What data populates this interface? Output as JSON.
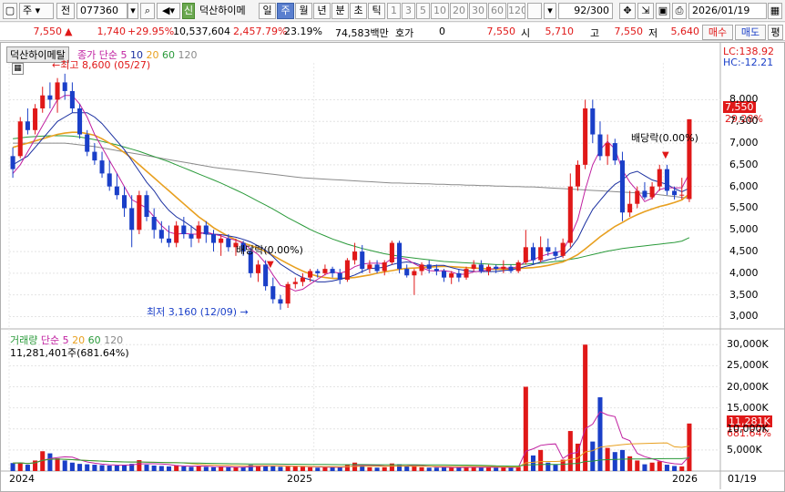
{
  "toolbar": {
    "market": "주",
    "type": "전",
    "code": "077360",
    "stock_name": "덕산하이메",
    "periods": [
      "일",
      "주",
      "월",
      "년",
      "분",
      "초",
      "틱"
    ],
    "active_period": "주",
    "intervals": [
      "1",
      "3",
      "5",
      "10",
      "20",
      "30",
      "60",
      "120"
    ],
    "count": "92/300",
    "date": "2026/01/19"
  },
  "info": {
    "price": "7,550",
    "change": "1,740",
    "change_pct": "+29.95%",
    "volume": "10,537,604",
    "volume_pct": "2,457.79%",
    "turnover": "23.19%",
    "amount": "74,583백만",
    "hoga_label": "호가",
    "hoga_value": "0",
    "hoga_price": "7,550",
    "open_label": "시",
    "open": "5,710",
    "high_label": "고",
    "high": "7,550",
    "low_label": "저",
    "low": "5,640",
    "buy": "매수",
    "sell": "매도",
    "eval": "평"
  },
  "price_panel": {
    "name_tag": "덕산하이메탈",
    "legend_prefix": "종가 단순",
    "legend_ma": [
      "5",
      "10",
      "20",
      "60",
      "120"
    ],
    "lc": "LC:138.92",
    "hc": "HC:-12.21",
    "current_tag": "7,550",
    "current_pct": "29.28%",
    "high_note": "최고 8,600 (05/27)",
    "low_note": "최저 3,160 (12/09)",
    "div1": "배당락(0.00%)",
    "div2": "배당락(0.00%)",
    "y_ticks": [
      "8,000",
      "7,500",
      "7,000",
      "6,500",
      "6,000",
      "5,500",
      "5,000",
      "4,500",
      "4,000",
      "3,500",
      "3,000"
    ]
  },
  "volume_panel": {
    "title": "거래량",
    "legend_prefix": "단순",
    "legend_ma": [
      "5",
      "20",
      "60",
      "120"
    ],
    "current": "11,281,401주(681.64%)",
    "tag": "11,281K",
    "tag_pct": "681.64%",
    "y_ticks": [
      "30,000K",
      "25,000K",
      "20,000K",
      "15,000K",
      "10,000K",
      "5,000K"
    ]
  },
  "x_axis": {
    "labels": [
      "2024",
      "2025",
      "2026"
    ],
    "right": "01/19"
  },
  "colors": {
    "up": "#e01818",
    "down": "#1a3fc8",
    "ma5": "#c020a0",
    "ma10": "#1a2fa0",
    "ma20": "#e8a020",
    "ma60": "#2a9a3a",
    "ma120": "#8a8a8a"
  },
  "chart_data": {
    "type": "candlestick",
    "candles": [
      [
        6700,
        6900,
        6200,
        6400
      ],
      [
        6700,
        7600,
        6650,
        7500
      ],
      [
        7500,
        7800,
        7200,
        7300
      ],
      [
        7300,
        7900,
        7200,
        7800
      ],
      [
        7800,
        8300,
        7700,
        8100
      ],
      [
        8100,
        8400,
        7800,
        8000
      ],
      [
        8000,
        8500,
        7700,
        8400
      ],
      [
        8400,
        8600,
        8000,
        8200
      ],
      [
        8200,
        8400,
        7700,
        7800
      ],
      [
        7800,
        7900,
        7100,
        7200
      ],
      [
        7200,
        7300,
        6700,
        6800
      ],
      [
        6800,
        7000,
        6500,
        6600
      ],
      [
        6600,
        6800,
        6200,
        6300
      ],
      [
        6300,
        6600,
        5900,
        6000
      ],
      [
        6000,
        6300,
        5700,
        5800
      ],
      [
        5800,
        6000,
        5300,
        5500
      ],
      [
        5500,
        5800,
        4600,
        5000
      ],
      [
        5000,
        5900,
        4900,
        5800
      ],
      [
        5800,
        5900,
        5200,
        5300
      ],
      [
        5300,
        5500,
        4800,
        5000
      ],
      [
        5000,
        5200,
        4700,
        4800
      ],
      [
        4800,
        5100,
        4600,
        4700
      ],
      [
        4700,
        5200,
        4600,
        5100
      ],
      [
        5100,
        5300,
        4800,
        4900
      ],
      [
        4900,
        5100,
        4600,
        4800
      ],
      [
        4800,
        5200,
        4700,
        5100
      ],
      [
        5100,
        5200,
        4700,
        4900
      ],
      [
        4900,
        5000,
        4500,
        4700
      ],
      [
        4700,
        4900,
        4400,
        4800
      ],
      [
        4800,
        4900,
        4500,
        4600
      ],
      [
        4600,
        4800,
        4400,
        4700
      ],
      [
        4700,
        4750,
        4400,
        4500
      ],
      [
        4500,
        4600,
        3900,
        4000
      ],
      [
        4000,
        4300,
        3800,
        4200
      ],
      [
        4200,
        4300,
        3600,
        3700
      ],
      [
        3700,
        3900,
        3300,
        3400
      ],
      [
        3400,
        3500,
        3160,
        3300
      ],
      [
        3300,
        3800,
        3200,
        3750
      ],
      [
        3750,
        3900,
        3650,
        3800
      ],
      [
        3800,
        4000,
        3700,
        3900
      ],
      [
        3900,
        4100,
        3800,
        4050
      ],
      [
        4050,
        4100,
        3900,
        4000
      ],
      [
        4000,
        4200,
        3950,
        4100
      ],
      [
        4100,
        4150,
        3900,
        4000
      ],
      [
        4000,
        4100,
        3750,
        3850
      ],
      [
        3850,
        4350,
        3800,
        4300
      ],
      [
        4300,
        4700,
        4200,
        4500
      ],
      [
        4500,
        4650,
        4000,
        4100
      ],
      [
        4100,
        4300,
        4000,
        4200
      ],
      [
        4200,
        4300,
        4000,
        4050
      ],
      [
        4050,
        4300,
        3950,
        4250
      ],
      [
        4250,
        4750,
        4200,
        4700
      ],
      [
        4700,
        4750,
        4000,
        4100
      ],
      [
        4100,
        4200,
        3900,
        3950
      ],
      [
        3950,
        4100,
        3500,
        4050
      ],
      [
        4050,
        4250,
        3950,
        4200
      ],
      [
        4200,
        4300,
        4000,
        4100
      ],
      [
        4100,
        4200,
        3950,
        4050
      ],
      [
        4050,
        4100,
        3800,
        3900
      ],
      [
        3900,
        4050,
        3750,
        4000
      ],
      [
        4000,
        4100,
        3800,
        3900
      ],
      [
        3900,
        4150,
        3850,
        4100
      ],
      [
        4100,
        4300,
        4050,
        4200
      ],
      [
        4200,
        4300,
        4000,
        4050
      ],
      [
        4050,
        4200,
        3950,
        4150
      ],
      [
        4150,
        4200,
        4000,
        4100
      ],
      [
        4100,
        4300,
        4000,
        4150
      ],
      [
        4150,
        4200,
        4000,
        4050
      ],
      [
        4050,
        4300,
        4000,
        4250
      ],
      [
        4250,
        5000,
        4200,
        4600
      ],
      [
        4600,
        4700,
        4200,
        4300
      ],
      [
        4300,
        4850,
        4250,
        4600
      ],
      [
        4600,
        4800,
        4400,
        4500
      ],
      [
        4500,
        4600,
        4300,
        4400
      ],
      [
        4400,
        4800,
        4350,
        4700
      ],
      [
        4700,
        6300,
        4600,
        6000
      ],
      [
        6000,
        6600,
        5900,
        6500
      ],
      [
        6500,
        8000,
        6400,
        7800
      ],
      [
        7800,
        8000,
        7000,
        7200
      ],
      [
        7200,
        7500,
        6600,
        6700
      ],
      [
        6700,
        7200,
        6500,
        7000
      ],
      [
        7000,
        7100,
        6500,
        6600
      ],
      [
        6600,
        6800,
        5200,
        5400
      ],
      [
        5400,
        5900,
        5300,
        5600
      ],
      [
        5600,
        6000,
        5500,
        5900
      ],
      [
        5900,
        6100,
        5700,
        5750
      ],
      [
        5750,
        6100,
        5700,
        6000
      ],
      [
        6000,
        6500,
        5900,
        6400
      ],
      [
        6400,
        6500,
        5800,
        5900
      ],
      [
        5900,
        6000,
        5700,
        5800
      ],
      [
        5800,
        6200,
        5700,
        5810
      ],
      [
        5710,
        7550,
        5640,
        7550
      ]
    ],
    "volumes_k": [
      1900,
      2000,
      1500,
      2500,
      4700,
      4200,
      3000,
      2500,
      2000,
      1700,
      1600,
      1500,
      1400,
      1300,
      1300,
      1500,
      1700,
      2600,
      1500,
      1300,
      1200,
      1100,
      1400,
      1100,
      1000,
      1300,
      1000,
      900,
      1000,
      900,
      900,
      900,
      1500,
      1300,
      1300,
      1200,
      1000,
      1200,
      1100,
      1000,
      900,
      800,
      900,
      900,
      900,
      1500,
      2000,
      1400,
      900,
      800,
      900,
      1800,
      1600,
      1100,
      1200,
      900,
      800,
      800,
      1000,
      800,
      800,
      900,
      1000,
      800,
      900,
      800,
      900,
      800,
      1000,
      20000,
      3700,
      5000,
      2000,
      1500,
      2700,
      9500,
      6500,
      30000,
      7000,
      17500,
      5500,
      4500,
      5000,
      3500,
      2500,
      1600,
      2000,
      2300,
      1500,
      1200,
      1100,
      11281
    ],
    "ma5": [
      6300,
      6500,
      6800,
      7100,
      7400,
      7700,
      8000,
      8100,
      8100,
      7900,
      7600,
      7200,
      6900,
      6600,
      6300,
      6000,
      5700,
      5600,
      5500,
      5300,
      5100,
      4950,
      4900,
      4920,
      4900,
      4900,
      4950,
      4900,
      4860,
      4800,
      4760,
      4700,
      4550,
      4430,
      4230,
      3960,
      3720,
      3670,
      3590,
      3630,
      3750,
      3860,
      3970,
      4030,
      4000,
      4050,
      4150,
      4210,
      4230,
      4230,
      4220,
      4340,
      4360,
      4320,
      4220,
      4130,
      4060,
      4050,
      4060,
      4030,
      3970,
      3980,
      4030,
      4050,
      4080,
      4120,
      4130,
      4110,
      4160,
      4270,
      4310,
      4390,
      4440,
      4480,
      4520,
      4840,
      5240,
      5920,
      6500,
      6840,
      7040,
      6860,
      6380,
      6100,
      5900,
      5650,
      5730,
      5930,
      5970,
      5970,
      5970,
      6300
    ],
    "ma10": [
      6500,
      6600,
      6700,
      6900,
      7100,
      7300,
      7500,
      7600,
      7700,
      7700,
      7700,
      7600,
      7450,
      7250,
      7050,
      6850,
      6600,
      6350,
      6100,
      5900,
      5650,
      5450,
      5300,
      5200,
      5080,
      4950,
      4900,
      4900,
      4890,
      4860,
      4830,
      4780,
      4720,
      4630,
      4530,
      4380,
      4210,
      4100,
      3990,
      3900,
      3850,
      3800,
      3800,
      3820,
      3860,
      3900,
      3960,
      4040,
      4110,
      4120,
      4140,
      4200,
      4240,
      4260,
      4240,
      4180,
      4160,
      4180,
      4180,
      4130,
      4090,
      4060,
      4040,
      4040,
      4040,
      4040,
      4060,
      4080,
      4110,
      4160,
      4200,
      4260,
      4310,
      4350,
      4400,
      4570,
      4800,
      5150,
      5470,
      5680,
      5880,
      6050,
      6150,
      6300,
      6350,
      6250,
      6150,
      6100,
      6050,
      5950,
      5880,
      5960
    ],
    "ma20": [
      6900,
      6950,
      7000,
      7050,
      7100,
      7150,
      7200,
      7230,
      7250,
      7250,
      7220,
      7180,
      7100,
      7000,
      6900,
      6780,
      6650,
      6500,
      6350,
      6200,
      6050,
      5900,
      5750,
      5600,
      5450,
      5300,
      5180,
      5050,
      4950,
      4850,
      4770,
      4700,
      4640,
      4580,
      4500,
      4410,
      4310,
      4220,
      4130,
      4050,
      3980,
      3930,
      3900,
      3880,
      3880,
      3890,
      3900,
      3930,
      3960,
      4000,
      4030,
      4060,
      4090,
      4110,
      4120,
      4130,
      4140,
      4150,
      4160,
      4150,
      4140,
      4130,
      4120,
      4110,
      4100,
      4090,
      4090,
      4100,
      4110,
      4120,
      4130,
      4150,
      4180,
      4220,
      4260,
      4340,
      4430,
      4560,
      4700,
      4840,
      4960,
      5080,
      5170,
      5270,
      5350,
      5420,
      5480,
      5540,
      5580,
      5630,
      5690,
      5830
    ],
    "ma60": [
      7100,
      7120,
      7140,
      7150,
      7160,
      7170,
      7170,
      7170,
      7160,
      7140,
      7110,
      7080,
      7040,
      7000,
      6960,
      6910,
      6860,
      6810,
      6750,
      6690,
      6630,
      6570,
      6500,
      6430,
      6360,
      6290,
      6220,
      6150,
      6080,
      6000,
      5920,
      5840,
      5750,
      5660,
      5570,
      5480,
      5380,
      5280,
      5190,
      5100,
      5010,
      4930,
      4860,
      4790,
      4730,
      4670,
      4620,
      4570,
      4530,
      4490,
      4450,
      4420,
      4390,
      4370,
      4350,
      4330,
      4310,
      4290,
      4270,
      4260,
      4250,
      4240,
      4230,
      4220,
      4210,
      4200,
      4200,
      4200,
      4200,
      4210,
      4220,
      4230,
      4250,
      4270,
      4290,
      4320,
      4350,
      4390,
      4430,
      4470,
      4510,
      4540,
      4570,
      4590,
      4610,
      4630,
      4650,
      4670,
      4690,
      4710,
      4740,
      4820
    ],
    "ma120": [
      7000,
      7000,
      7000,
      7000,
      7000,
      7000,
      7000,
      7000,
      6980,
      6960,
      6940,
      6920,
      6890,
      6860,
      6830,
      6800,
      6770,
      6740,
      6710,
      6680,
      6650,
      6620,
      6590,
      6560,
      6530,
      6500,
      6470,
      6440,
      6420,
      6400,
      6380,
      6360,
      6340,
      6320,
      6300,
      6280,
      6260,
      6240,
      6220,
      6200,
      6190,
      6180,
      6170,
      6160,
      6150,
      6140,
      6130,
      6120,
      6110,
      6100,
      6090,
      6080,
      6080,
      6070,
      6070,
      6060,
      6060,
      6050,
      6050,
      6040,
      6040,
      6030,
      6030,
      6020,
      6020,
      6010,
      6010,
      6000,
      6000,
      5990,
      5990,
      5980,
      5970,
      5960,
      5950,
      5940,
      5930,
      5920,
      5910,
      5900,
      5890,
      5880,
      5870,
      5860,
      5850,
      5840,
      5830,
      5810,
      5790,
      5770,
      5750,
      5730
    ],
    "price_range": [
      2800,
      8850
    ],
    "volume_range_k": [
      0,
      32000
    ]
  }
}
